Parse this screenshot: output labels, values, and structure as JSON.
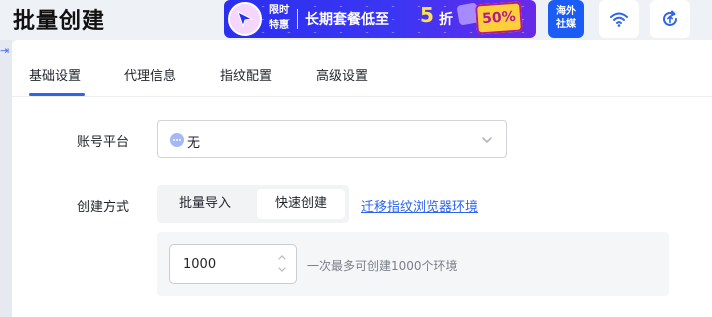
{
  "header": {
    "title": "批量创建"
  },
  "promo": {
    "tag_line1": "限时",
    "tag_line2": "特惠",
    "headline": "长期套餐低至",
    "big_number": "5",
    "unit": "折",
    "coupon_text": "50%",
    "accent": "#ffe14d",
    "bg": "#3b36f3"
  },
  "top_icons": {
    "haiwai_line1": "海外",
    "haiwai_line2": "社媒",
    "wifi": "wifi-icon",
    "sync": "sync-icon"
  },
  "tabs": [
    {
      "label": "基础设置",
      "active": true
    },
    {
      "label": "代理信息",
      "active": false
    },
    {
      "label": "指纹配置",
      "active": false
    },
    {
      "label": "高级设置",
      "active": false
    }
  ],
  "form": {
    "account_platform": {
      "label": "账号平台",
      "value": "无"
    },
    "create_method": {
      "label": "创建方式",
      "options": [
        "批量导入",
        "快速创建"
      ],
      "selected": "快速创建",
      "migrate_link": "迁移指纹浏览器环境"
    },
    "quantity": {
      "value": "1000",
      "hint": "一次最多可创建1000个环境"
    }
  },
  "colors": {
    "primary": "#2e63f0",
    "page_bg": "#eef1f6"
  }
}
